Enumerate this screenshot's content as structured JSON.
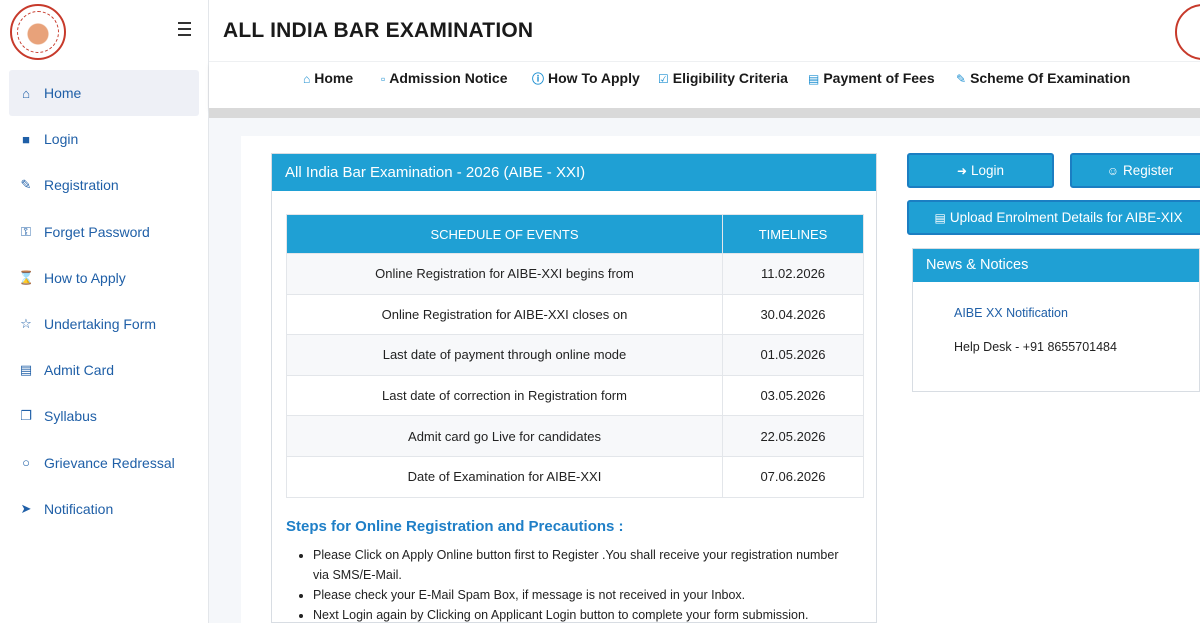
{
  "header": {
    "title": "ALL INDIA BAR EXAMINATION"
  },
  "sidebar": {
    "items": [
      {
        "label": "Home",
        "icon": "home-icon"
      },
      {
        "label": "Login",
        "icon": "lock-icon"
      },
      {
        "label": "Registration",
        "icon": "edit-icon"
      },
      {
        "label": "Forget Password",
        "icon": "key-icon"
      },
      {
        "label": "How to Apply",
        "icon": "hourglass-icon"
      },
      {
        "label": "Undertaking Form",
        "icon": "handshake-icon"
      },
      {
        "label": "Admit Card",
        "icon": "id-card-icon"
      },
      {
        "label": "Syllabus",
        "icon": "copy-icon"
      },
      {
        "label": "Grievance Redressal",
        "icon": "comments-icon"
      },
      {
        "label": "Notification",
        "icon": "bullhorn-icon"
      }
    ]
  },
  "topnav": {
    "items": [
      {
        "label": "Home",
        "icon": "home-icon"
      },
      {
        "label": "Admission Notice",
        "icon": "file-icon"
      },
      {
        "label": "How To Apply",
        "icon": "question-circle-icon"
      },
      {
        "label": "Eligibility Criteria",
        "icon": "check-square-icon"
      },
      {
        "label": "Payment of Fees",
        "icon": "credit-card-icon"
      },
      {
        "label": "Scheme Of Examination",
        "icon": "edit-icon"
      }
    ]
  },
  "panel": {
    "title": "All India Bar Examination - 2026 (AIBE - XXI)",
    "schedule": {
      "headers": [
        "SCHEDULE OF EVENTS",
        "TIMELINES"
      ],
      "rows": [
        [
          "Online Registration for AIBE-XXI begins from",
          "11.02.2026"
        ],
        [
          "Online Registration for AIBE-XXI closes on",
          "30.04.2026"
        ],
        [
          "Last date of payment through online mode",
          "01.05.2026"
        ],
        [
          "Last date of correction in Registration form",
          "03.05.2026"
        ],
        [
          "Admit card go Live for candidates",
          "22.05.2026"
        ],
        [
          "Date of Examination for AIBE-XXI",
          "07.06.2026"
        ]
      ]
    },
    "steps_title": "Steps for Online Registration and Precautions :",
    "steps": [
      "Please Click on Apply Online button first to Register .You shall receive your registration number via SMS/E-Mail.",
      "Please check your E-Mail Spam Box, if message is not received in your Inbox.",
      "Next Login again by Clicking on Applicant Login button to complete your form submission."
    ]
  },
  "actions": {
    "login": "Login",
    "register": "Register",
    "upload": "Upload Enrolment Details for AIBE-XIX"
  },
  "news": {
    "title": "News & Notices",
    "link": "AIBE XX Notification",
    "helpdesk": "Help Desk - +91 8655701484"
  },
  "colors": {
    "accent": "#1fa0d4",
    "link": "#1f5fa7",
    "steps_title": "#1f7fc7"
  }
}
